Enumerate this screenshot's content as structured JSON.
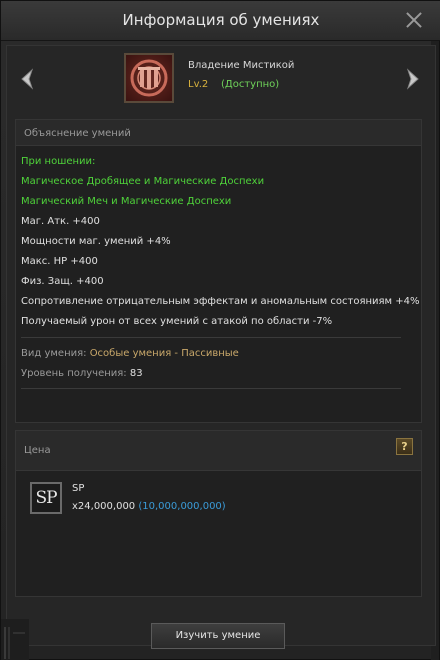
{
  "window": {
    "title": "Информация об умениях"
  },
  "skill": {
    "name": "Владение Мистикой",
    "level": "Lv.2",
    "status": "(Доступно)",
    "icon": "mystic-skill-icon"
  },
  "explanation": {
    "header": "Объяснение умений",
    "lines": [
      "При ношении:",
      "Магическое Дробящее и Магические Доспехи",
      "Магический Меч и Магические Доспехи",
      "Маг. Атк. +400",
      "Мощности маг. умений +4%",
      "Макс. HP +400",
      "Физ. Защ. +400",
      "Сопротивление отрицательным эффектам и аномальным состояниям +4%",
      "Получаемый урон от всех умений с атакой по области -7%"
    ],
    "skill_type_label": "Вид умения:",
    "skill_type_value": "Особые умения - Пассивные",
    "acquire_level_label": "Уровень получения:",
    "acquire_level_value": "83"
  },
  "price": {
    "header": "Цена",
    "help_label": "?",
    "currency_icon_text": "SP",
    "currency_name": "SP",
    "amount": "x24,000,000",
    "owned": "(10,000,000,000)"
  },
  "footer": {
    "learn_button": "Изучить умение"
  },
  "colors": {
    "green_text": "#4fd33a",
    "gold_text": "#d8b23e",
    "owned_blue": "#3a9bd8"
  }
}
